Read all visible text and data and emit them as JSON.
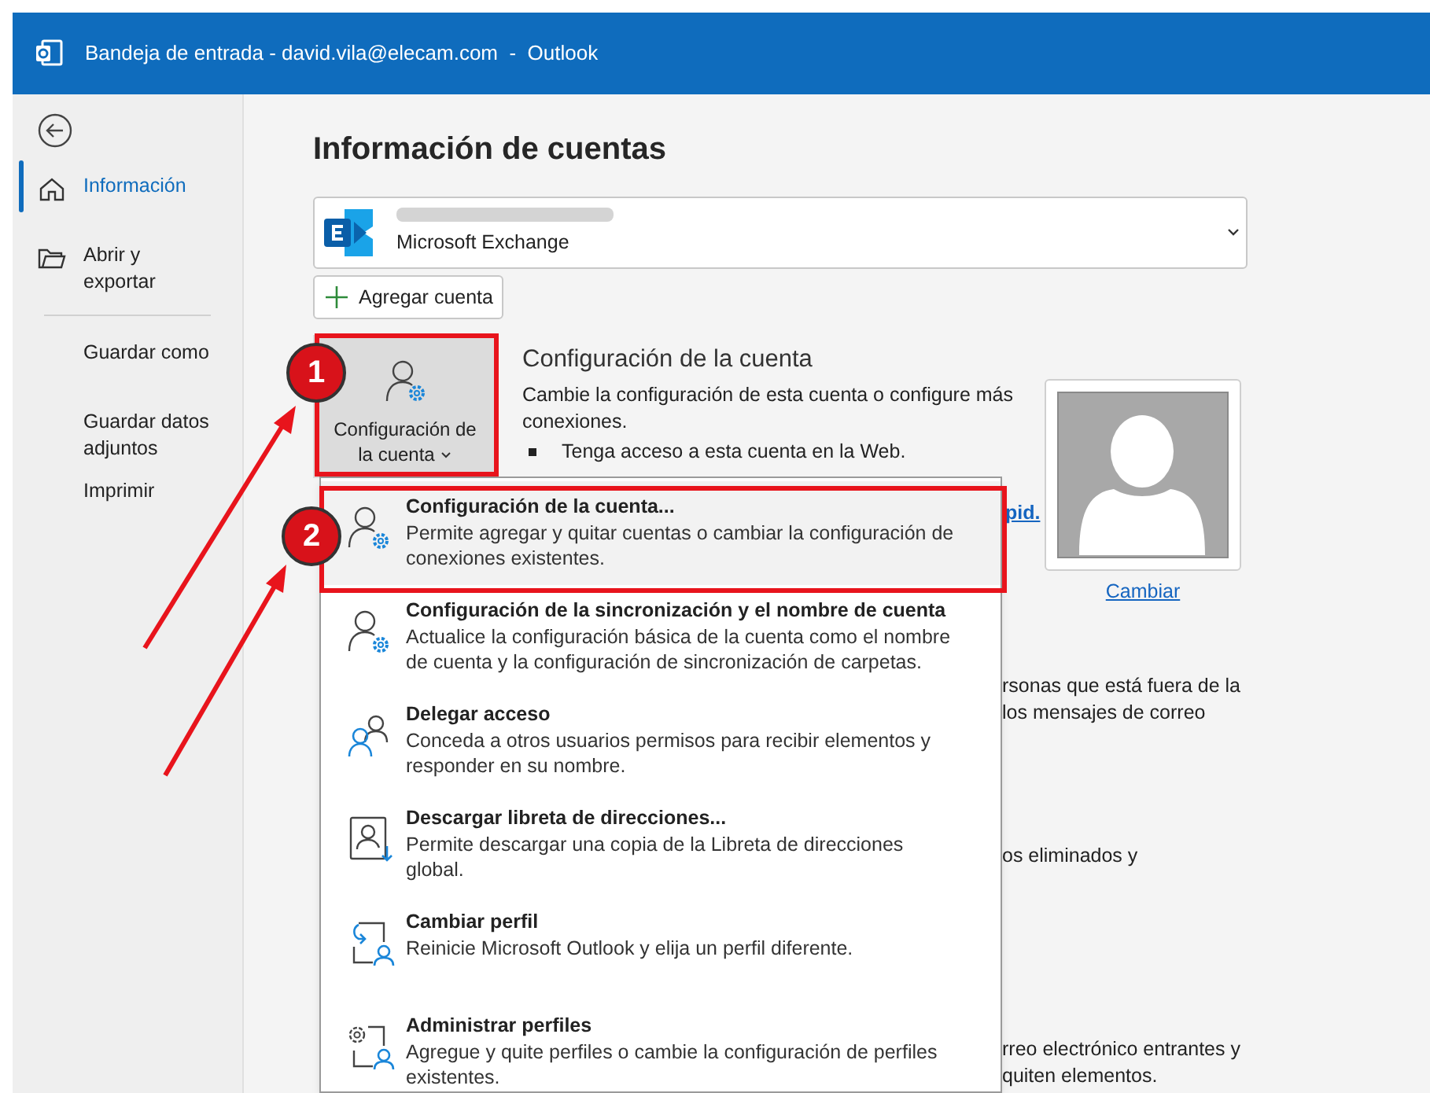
{
  "window": {
    "title": "Bandeja de entrada - david.vila@elecam.com  -  Outlook"
  },
  "sidebar": {
    "items": [
      {
        "label": "Información",
        "kind": "home",
        "selected": true
      },
      {
        "label": "Abrir y exportar",
        "kind": "folder",
        "selected": false
      },
      {
        "label": "Guardar como",
        "kind": "plain",
        "selected": false
      },
      {
        "label": "Guardar datos adjuntos",
        "kind": "plain",
        "selected": false
      },
      {
        "label": "Imprimir",
        "kind": "plain",
        "selected": false
      }
    ]
  },
  "main": {
    "heading": "Información de cuentas",
    "account": {
      "type": "Microsoft Exchange"
    },
    "add_account_button": "Agregar cuenta",
    "account_settings": {
      "button_label": "Configuración de la cuenta",
      "selected": true,
      "heading": "Configuración de la cuenta",
      "description": "Cambie la configuración de esta cuenta o configure más conexiones.",
      "bullet": "Tenga acceso a esta cuenta en la Web.",
      "link_fragment": "pid."
    },
    "avatar": {
      "change_link": "Cambiar"
    },
    "background_paragraphs": [
      [
        "rsonas que está fuera de la",
        "los mensajes de correo"
      ],
      [
        "os eliminados y"
      ],
      [
        "rreo electrónico entrantes y",
        "quiten elementos."
      ]
    ]
  },
  "menu": {
    "items": [
      {
        "kind": "person-gear",
        "title": "Configuración de la cuenta...",
        "description": "Permite agregar y quitar cuentas o cambiar la configuración de conexiones existentes.",
        "highlighted": true
      },
      {
        "kind": "person-gear",
        "title": "Configuración de la sincronización y el nombre de cuenta",
        "description": "Actualice la configuración básica de la cuenta como el nombre de cuenta y la configuración de sincronización de carpetas.",
        "highlighted": false
      },
      {
        "kind": "people",
        "title": "Delegar acceso",
        "description": "Conceda a otros usuarios permisos para recibir elementos y responder en su nombre.",
        "highlighted": false
      },
      {
        "kind": "address-book",
        "title": "Descargar libreta de direcciones...",
        "description": "Permite descargar una copia de la Libreta de direcciones global.",
        "highlighted": false
      },
      {
        "kind": "switch-profile",
        "title": "Cambiar perfil",
        "description": "Reinicie Microsoft Outlook y elija un perfil diferente.",
        "highlighted": false
      },
      {
        "kind": "manage-profiles",
        "title": "Administrar perfiles",
        "description": "Agregue y quite perfiles o cambie la configuración de perfiles existentes.",
        "highlighted": false
      }
    ]
  },
  "annotations": [
    {
      "number": "1"
    },
    {
      "number": "2"
    }
  ]
}
